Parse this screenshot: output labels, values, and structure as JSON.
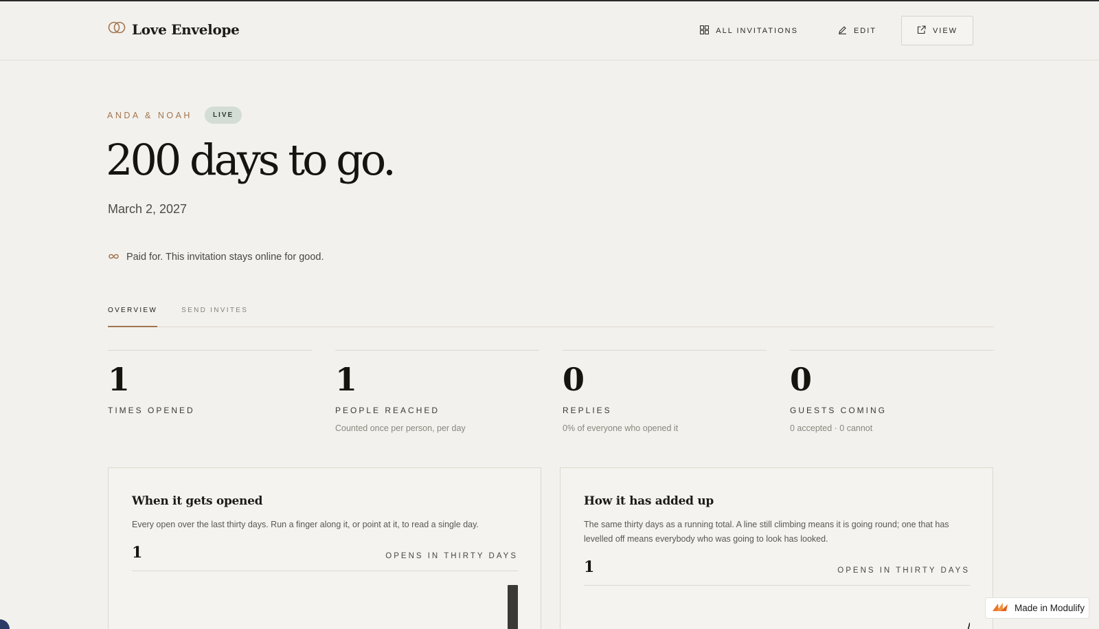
{
  "header": {
    "brand": "Love Envelope",
    "nav": {
      "all_invitations": "ALL INVITATIONS",
      "edit": "EDIT",
      "view": "VIEW"
    }
  },
  "hero": {
    "couple": "ANDA & NOAH",
    "status_badge": "LIVE",
    "headline": "200 days to go.",
    "date": "March 2, 2027",
    "paid_note": "Paid for. This invitation stays online for good."
  },
  "tabs": [
    {
      "label": "OVERVIEW",
      "active": true
    },
    {
      "label": "SEND INVITES",
      "active": false
    }
  ],
  "stats": [
    {
      "value": "1",
      "label": "TIMES OPENED",
      "note": ""
    },
    {
      "value": "1",
      "label": "PEOPLE REACHED",
      "note": "Counted once per person, per day"
    },
    {
      "value": "0",
      "label": "REPLIES",
      "note": "0% of everyone who opened it"
    },
    {
      "value": "0",
      "label": "GUESTS COMING",
      "note": "0 accepted · 0 cannot"
    }
  ],
  "cards": {
    "opens": {
      "title": "When it gets opened",
      "description": "Every open over the last thirty days. Run a finger along it, or point at it, to read a single day.",
      "metric_value": "1",
      "metric_label": "OPENS IN THIRTY DAYS"
    },
    "cumulative": {
      "title": "How it has added up",
      "description": "The same thirty days as a running total. A line still climbing means it is going round; one that has levelled off means everybody who was going to look has looked.",
      "metric_value": "1",
      "metric_label": "OPENS IN THIRTY DAYS"
    }
  },
  "made_badge": "Made in Modulify",
  "colors": {
    "accent": "#a2754f",
    "background": "#f3f1ed",
    "live_badge": "#d3ddd5"
  }
}
